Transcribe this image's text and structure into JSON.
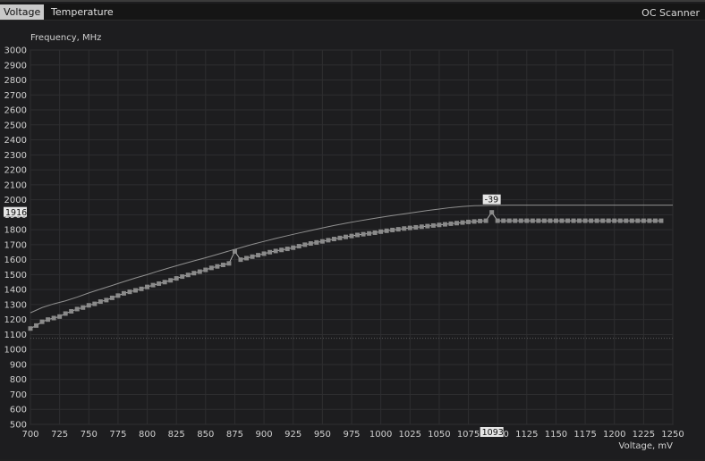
{
  "tabs": [
    {
      "label": "Voltage",
      "active": true
    },
    {
      "label": "Temperature",
      "active": false
    }
  ],
  "oc_scanner_label": "OC Scanner",
  "colors": {
    "background": "#1d1d1f",
    "grid": "#2e2e30",
    "curve_points": "#8a8a8a",
    "reference_line": "#909090",
    "dotted_line": "#5a5a5a"
  },
  "chart_data": {
    "type": "line",
    "ylabel": "Frequency, MHz",
    "xlabel": "Voltage, mV",
    "xlim": [
      700,
      1250
    ],
    "ylim": [
      500,
      3000
    ],
    "x_ticks": [
      700,
      725,
      750,
      775,
      800,
      825,
      850,
      875,
      900,
      925,
      950,
      975,
      1000,
      1025,
      1050,
      1075,
      1100,
      1125,
      1150,
      1175,
      1200,
      1225,
      1250
    ],
    "y_ticks": [
      500,
      600,
      700,
      800,
      900,
      1000,
      1100,
      1200,
      1300,
      1400,
      1500,
      1600,
      1700,
      1800,
      1900,
      2000,
      2100,
      2200,
      2300,
      2400,
      2500,
      2600,
      2700,
      2800,
      2900,
      3000
    ],
    "current_frequency_label": "1916",
    "current_voltage_label": "1093",
    "offset_label": "-39",
    "dotted_line_y": 1075,
    "grid": true,
    "series": [
      {
        "role": "reference",
        "x": [
          700,
          710,
          720,
          730,
          740,
          750,
          760,
          770,
          780,
          790,
          800,
          810,
          820,
          830,
          840,
          850,
          860,
          870,
          880,
          890,
          900,
          910,
          920,
          930,
          940,
          950,
          960,
          970,
          980,
          990,
          1000,
          1010,
          1020,
          1030,
          1040,
          1050,
          1060,
          1070,
          1080,
          1090,
          1100,
          1110,
          1120,
          1250
        ],
        "y": [
          1245,
          1280,
          1305,
          1325,
          1350,
          1378,
          1403,
          1428,
          1453,
          1478,
          1500,
          1525,
          1548,
          1570,
          1592,
          1613,
          1635,
          1658,
          1680,
          1702,
          1722,
          1742,
          1760,
          1778,
          1795,
          1812,
          1828,
          1843,
          1857,
          1870,
          1883,
          1895,
          1906,
          1917,
          1928,
          1938,
          1948,
          1955,
          1960,
          1962,
          1963,
          1964,
          1964,
          1964
        ]
      },
      {
        "role": "curve",
        "x": [
          700,
          705,
          710,
          715,
          720,
          725,
          730,
          735,
          740,
          745,
          750,
          755,
          760,
          765,
          770,
          775,
          780,
          785,
          790,
          795,
          800,
          805,
          810,
          815,
          820,
          825,
          830,
          835,
          840,
          845,
          850,
          855,
          860,
          865,
          870,
          875,
          880,
          885,
          890,
          895,
          900,
          905,
          910,
          915,
          920,
          925,
          930,
          935,
          940,
          945,
          950,
          955,
          960,
          965,
          970,
          975,
          980,
          985,
          990,
          995,
          1000,
          1005,
          1010,
          1015,
          1020,
          1025,
          1030,
          1035,
          1040,
          1045,
          1050,
          1055,
          1060,
          1065,
          1070,
          1075,
          1080,
          1085,
          1090,
          1095,
          1100,
          1105,
          1110,
          1115,
          1120,
          1125,
          1130,
          1135,
          1140,
          1145,
          1150,
          1155,
          1160,
          1165,
          1170,
          1175,
          1180,
          1185,
          1190,
          1195,
          1200,
          1205,
          1210,
          1215,
          1220,
          1225,
          1230,
          1235,
          1240
        ],
        "y": [
          1140,
          1160,
          1185,
          1200,
          1210,
          1220,
          1240,
          1255,
          1270,
          1280,
          1295,
          1305,
          1320,
          1330,
          1345,
          1360,
          1375,
          1385,
          1395,
          1405,
          1418,
          1430,
          1440,
          1450,
          1462,
          1475,
          1487,
          1498,
          1510,
          1520,
          1532,
          1545,
          1555,
          1565,
          1575,
          1655,
          1600,
          1610,
          1620,
          1630,
          1640,
          1650,
          1658,
          1665,
          1672,
          1680,
          1690,
          1700,
          1708,
          1715,
          1722,
          1730,
          1738,
          1745,
          1752,
          1758,
          1765,
          1770,
          1775,
          1780,
          1787,
          1793,
          1798,
          1803,
          1808,
          1812,
          1816,
          1820,
          1824,
          1828,
          1832,
          1836,
          1840,
          1844,
          1848,
          1852,
          1855,
          1858,
          1860,
          1916,
          1860,
          1860,
          1860,
          1860,
          1860,
          1860,
          1860,
          1860,
          1860,
          1860,
          1860,
          1860,
          1860,
          1860,
          1860,
          1860,
          1860,
          1860,
          1860,
          1860,
          1860,
          1860,
          1860,
          1860,
          1860,
          1860,
          1860,
          1860,
          1860
        ]
      }
    ]
  }
}
